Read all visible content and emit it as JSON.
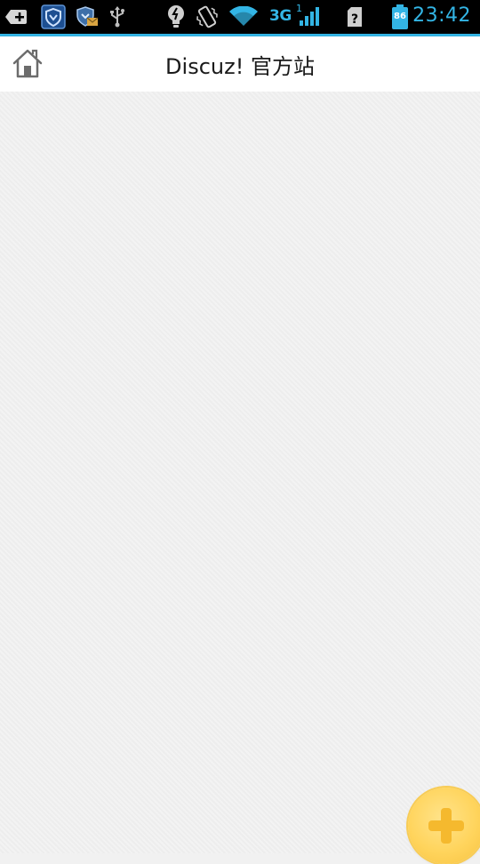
{
  "status_bar": {
    "icons": [
      "add-notification-icon",
      "shield-app-icon",
      "shield-mail-icon",
      "usb-icon",
      "lightbulb-icon",
      "vibrate-icon",
      "wifi-icon",
      "cell-signal-icon",
      "no-sim-icon",
      "battery-icon"
    ],
    "network_type": "3G",
    "signal_superscript": "1",
    "battery_level": "86",
    "time": "23:42"
  },
  "header": {
    "title": "Discuz! 官方站",
    "home_icon": "home-icon"
  },
  "fab": {
    "icon": "plus-icon"
  },
  "colors": {
    "accent": "#33b5e5",
    "fab": "#ffd45c",
    "background": "#f0f0f0"
  }
}
